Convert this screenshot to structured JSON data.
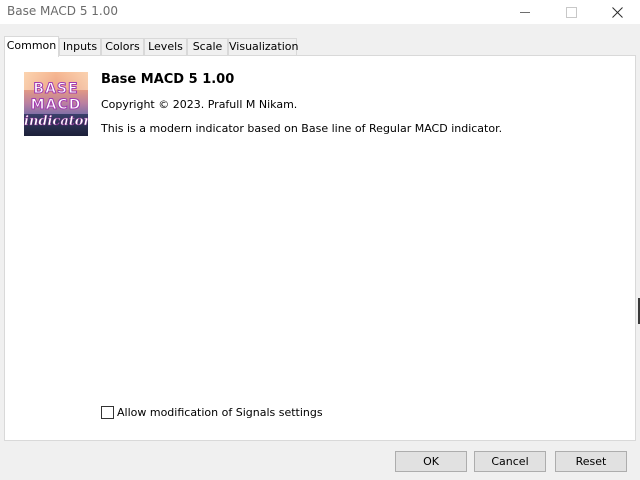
{
  "window": {
    "title": "Base MACD 5 1.00"
  },
  "tabs": [
    {
      "label": "Common",
      "active": true
    },
    {
      "label": "Inputs",
      "active": false
    },
    {
      "label": "Colors",
      "active": false
    },
    {
      "label": "Levels",
      "active": false
    },
    {
      "label": "Scale",
      "active": false
    },
    {
      "label": "Visualization",
      "active": false
    }
  ],
  "info": {
    "logo_text": [
      "BASE",
      "MACD",
      "indicator"
    ],
    "title": "Base MACD 5 1.00",
    "copyright": "Copyright © 2023. Prafull M Nikam.",
    "description": "This is a modern indicator based on Base line of Regular MACD indicator."
  },
  "options": {
    "allow_modification_label": "Allow modification of Signals settings",
    "allow_modification_checked": false
  },
  "buttons": {
    "ok": "OK",
    "cancel": "Cancel",
    "reset": "Reset"
  },
  "icons": {
    "minimize": "minimize-icon",
    "maximize": "maximize-icon",
    "close": "close-icon"
  }
}
